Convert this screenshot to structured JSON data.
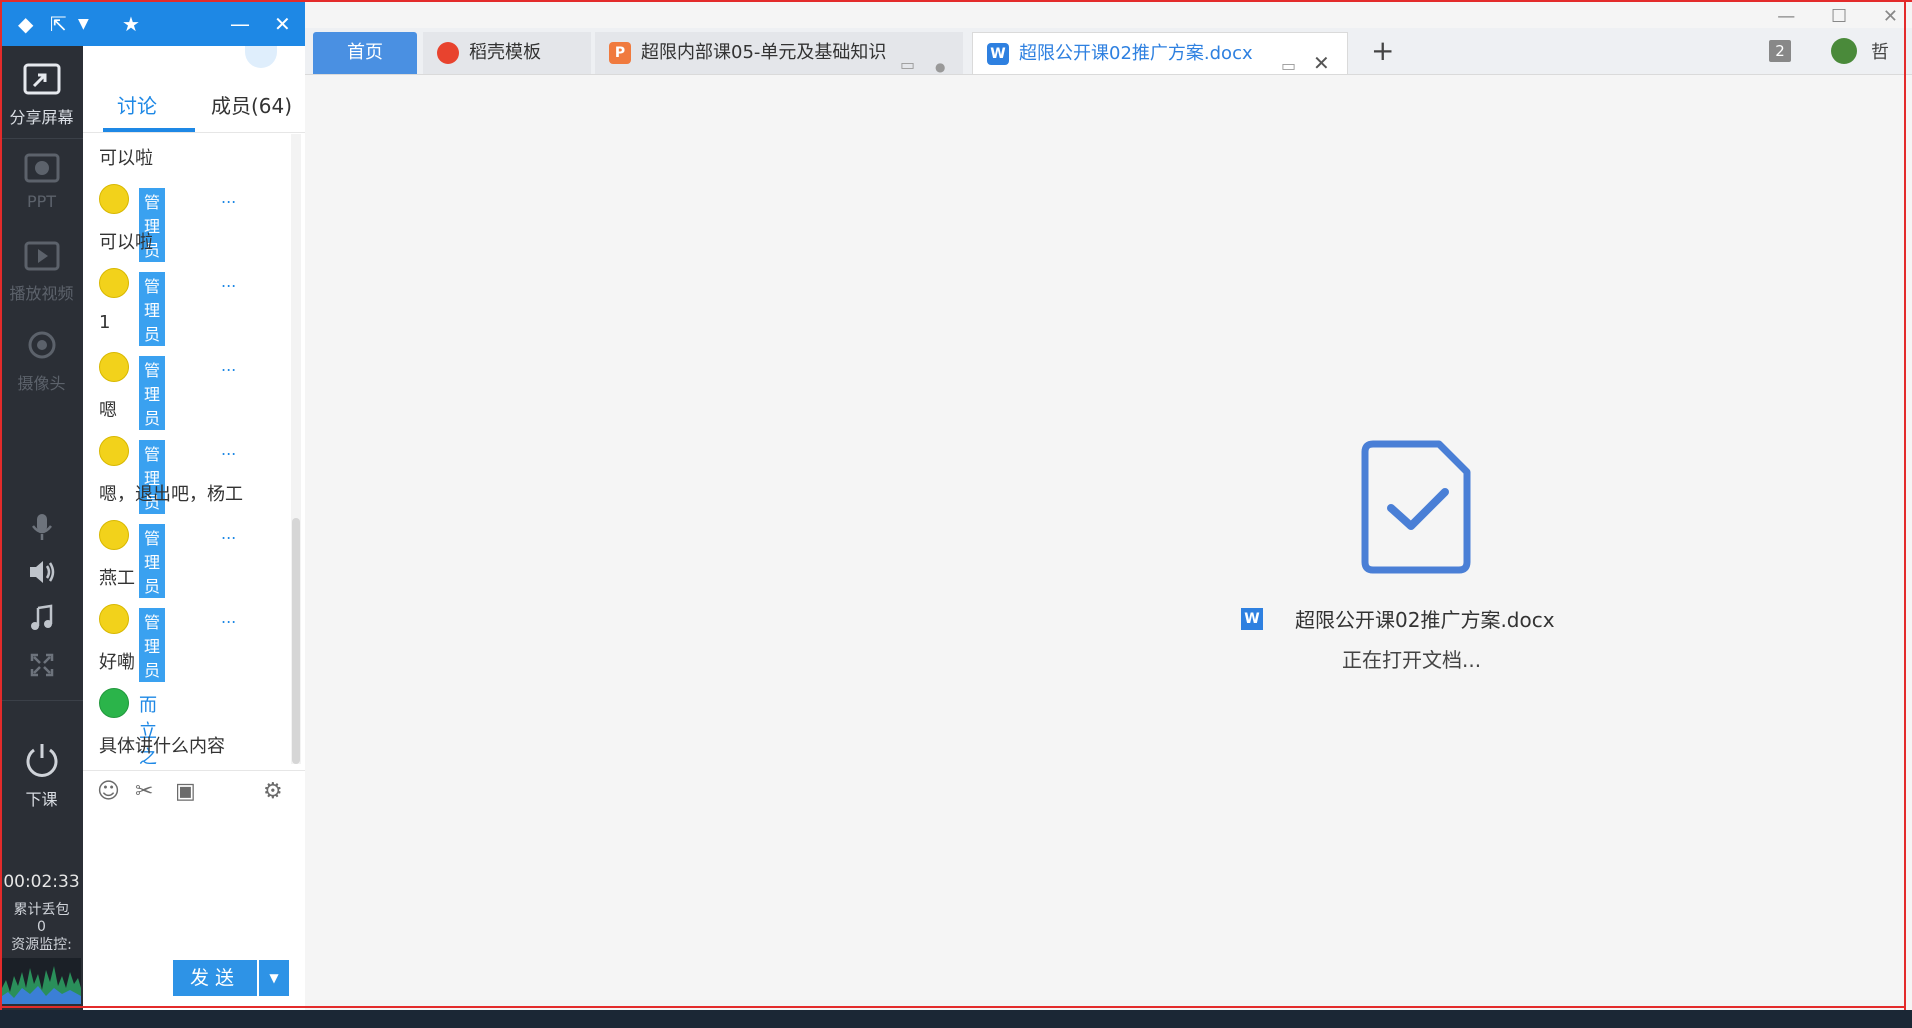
{
  "left_toolbar": {
    "items": [
      {
        "label": "分享屏幕",
        "icon": "share-screen-icon",
        "active": true
      },
      {
        "label": "PPT",
        "icon": "ppt-icon",
        "active": false
      },
      {
        "label": "播放视频",
        "icon": "play-video-icon",
        "active": false
      },
      {
        "label": "摄像头",
        "icon": "camera-icon",
        "active": false
      }
    ],
    "icons_mid": [
      "microphone-icon",
      "speaker-icon",
      "music-icon",
      "expand-icon"
    ],
    "end_class": {
      "label": "下课",
      "icon": "power-icon"
    },
    "timer": "00:02:33",
    "packet_loss_label": "累计丢包",
    "packet_loss_value": "0",
    "resource_monitor_label": "资源监控:"
  },
  "chat": {
    "tabs": [
      {
        "label": "讨论",
        "active": true
      },
      {
        "label": "成员(64)",
        "active": false
      }
    ],
    "admin_badge": "管理员",
    "ellipsis": "...",
    "first_message": "可以啦",
    "messages": [
      {
        "type": "admin",
        "text": "可以啦"
      },
      {
        "type": "admin",
        "text": "1"
      },
      {
        "type": "admin",
        "text": "嗯"
      },
      {
        "type": "admin",
        "text": "嗯，退出吧，杨工"
      },
      {
        "type": "admin",
        "text": "燕工"
      },
      {
        "type": "admin",
        "text": "好嘞"
      },
      {
        "type": "wechat",
        "name": "而立之年",
        "text": "具体讲什么内容"
      }
    ],
    "send_label": "发送"
  },
  "browser": {
    "tabs": [
      {
        "label": "首页",
        "icon": "home-tab"
      },
      {
        "label": "稻壳模板",
        "icon": "wps-icon"
      },
      {
        "label": "超限内部课05-单元及基础知识",
        "icon": "ppt-file-icon"
      },
      {
        "label": "超限公开课02推广方案.docx",
        "icon": "word-file-icon",
        "active": true
      }
    ],
    "badge_count": "2",
    "user_short": "哲"
  },
  "document": {
    "filename": "超限公开课02推广方案.docx",
    "status": "正在打开文档..."
  },
  "colors": {
    "accent_blue": "#1e88e5",
    "toolbar_dark": "#2b2f36",
    "admin_badge": "#3aa1f0",
    "doc_icon_blue": "#4a7fd6"
  }
}
